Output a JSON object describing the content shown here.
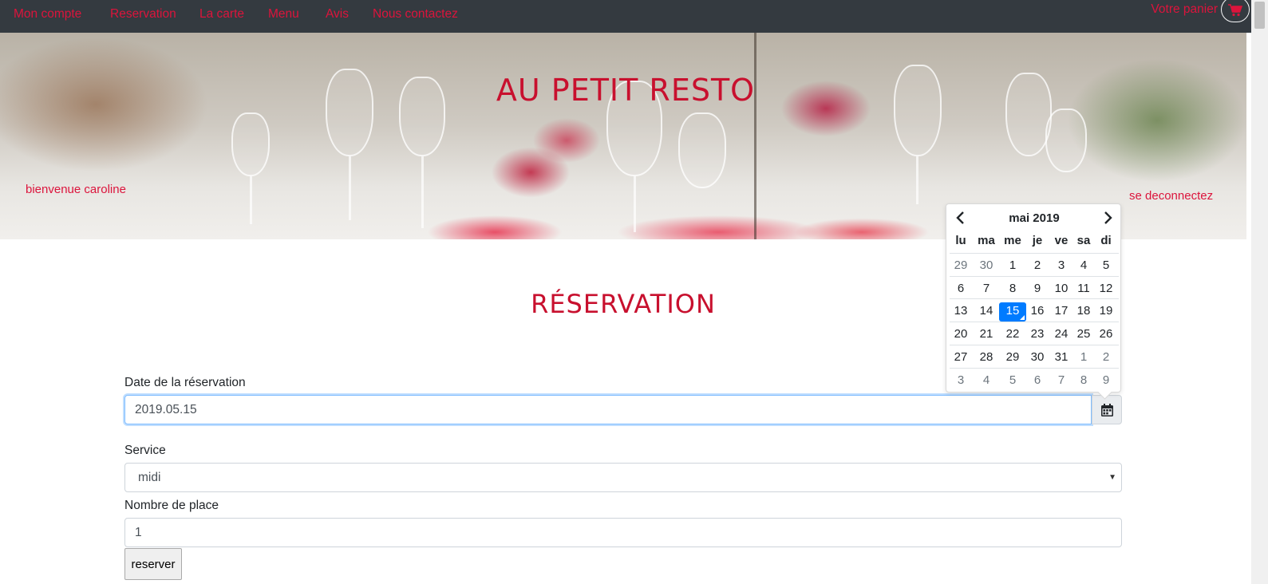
{
  "nav": {
    "items": [
      "Mon compte",
      "Reservation",
      "La carte",
      "Menu",
      "Avis",
      "Nous contactez"
    ],
    "cart_label": "Votre panier",
    "cart_icon": "shopping-cart-icon"
  },
  "hero": {
    "title": "AU PETIT RESTO",
    "welcome": "bienvenue caroline",
    "logout": "se deconnectez"
  },
  "main": {
    "heading": "RÉSERVATION",
    "date_label": "Date de la réservation",
    "date_value": "2019.05.15",
    "calendar_icon": "calendar-icon",
    "service_label": "Service",
    "service_value": "midi",
    "places_label": "Nombre de place",
    "places_value": "1",
    "submit_label": "reserver"
  },
  "datepicker": {
    "title": "mai 2019",
    "weekdays": [
      "lu",
      "ma",
      "me",
      "je",
      "ve",
      "sa",
      "di"
    ],
    "weeks": [
      [
        [
          "29",
          "muted"
        ],
        [
          "30",
          "muted"
        ],
        [
          "1",
          ""
        ],
        [
          "2",
          ""
        ],
        [
          "3",
          ""
        ],
        [
          "4",
          ""
        ],
        [
          "5",
          ""
        ]
      ],
      [
        [
          "6",
          ""
        ],
        [
          "7",
          ""
        ],
        [
          "8",
          ""
        ],
        [
          "9",
          ""
        ],
        [
          "10",
          ""
        ],
        [
          "11",
          ""
        ],
        [
          "12",
          ""
        ]
      ],
      [
        [
          "13",
          ""
        ],
        [
          "14",
          ""
        ],
        [
          "15",
          "active"
        ],
        [
          "16",
          ""
        ],
        [
          "17",
          ""
        ],
        [
          "18",
          ""
        ],
        [
          "19",
          ""
        ]
      ],
      [
        [
          "20",
          ""
        ],
        [
          "21",
          ""
        ],
        [
          "22",
          ""
        ],
        [
          "23",
          ""
        ],
        [
          "24",
          ""
        ],
        [
          "25",
          ""
        ],
        [
          "26",
          ""
        ]
      ],
      [
        [
          "27",
          ""
        ],
        [
          "28",
          ""
        ],
        [
          "29",
          ""
        ],
        [
          "30",
          ""
        ],
        [
          "31",
          ""
        ],
        [
          "1",
          "muted"
        ],
        [
          "2",
          "muted"
        ]
      ],
      [
        [
          "3",
          "muted"
        ],
        [
          "4",
          "muted"
        ],
        [
          "5",
          "muted"
        ],
        [
          "6",
          "muted"
        ],
        [
          "7",
          "muted"
        ],
        [
          "8",
          "muted"
        ],
        [
          "9",
          "muted"
        ]
      ]
    ]
  },
  "colors": {
    "accent_red": "#dc143c",
    "navbar": "#343a40",
    "active_day": "#007bff"
  }
}
